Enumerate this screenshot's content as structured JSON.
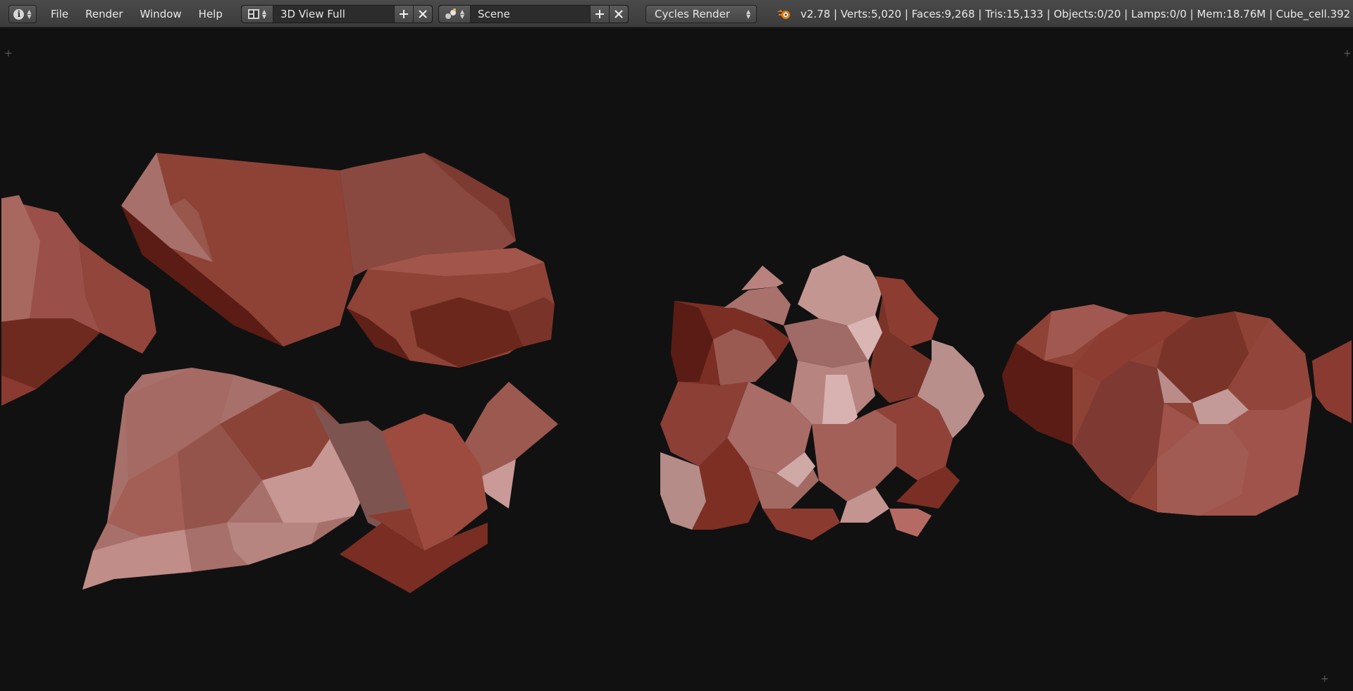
{
  "menu": [
    "File",
    "Render",
    "Window",
    "Help"
  ],
  "layout": {
    "value": "3D View Full"
  },
  "scene": {
    "value": "Scene"
  },
  "render_engine": "Cycles Render",
  "stats": "v2.78 | Verts:5,020 | Faces:9,268 | Tris:15,133 | Objects:0/20 | Lamps:0/0 | Mem:18.76M | Cube_cell.392",
  "icons": {
    "editor_type": "info-icon",
    "layout": "screen-layout-icon",
    "scene": "scene-icon",
    "add": "plus-icon",
    "remove": "close-icon",
    "app": "blender-logo-icon"
  },
  "colors": {
    "background": "#111111",
    "header": "#444444",
    "field": "#2c2c2c",
    "rock_light": "#9d6460",
    "rock_mid": "#8c4538",
    "rock_dark": "#5a1c14"
  }
}
